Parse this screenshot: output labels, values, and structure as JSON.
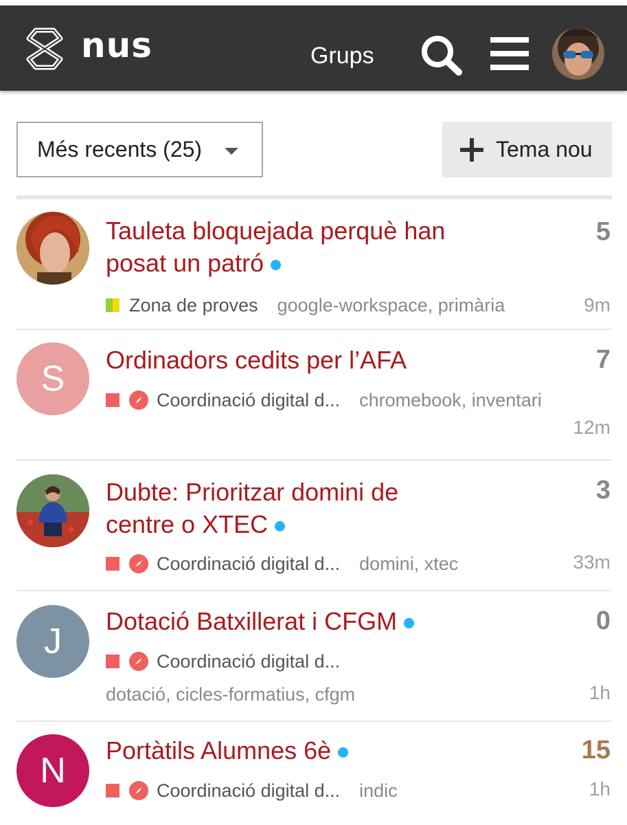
{
  "header": {
    "brand": "nus",
    "groups_link": "Grups",
    "search_icon": "search-icon",
    "menu_icon": "hamburger-icon",
    "user_avatar": "user-avatar"
  },
  "controls": {
    "filter_label": "Més recents (25)",
    "new_topic_label": "Tema nou"
  },
  "topics": [
    {
      "title_line1": "Tauleta bloquejada perquè han",
      "title_line2": "posat un patró",
      "unread": true,
      "count": "5",
      "category": "Zona de proves",
      "category_colors": [
        "#9acd32",
        "#f5d90f"
      ],
      "tags": "google-workspace, primària",
      "age": "9m",
      "avatar": "photo"
    },
    {
      "title_line1": "Ordinadors cedits per l’AFA",
      "count": "7",
      "category": "Coordinació digital d...",
      "category_color": "#f06060",
      "tags": "chromebook, inventari",
      "age": "12m",
      "avatar_letter": "S",
      "avatar_color": "#e8a0a0"
    },
    {
      "title_line1": "Dubte: Prioritzar domini de",
      "title_line2": "centre o XTEC",
      "unread": true,
      "count": "3",
      "category": "Coordinació digital d...",
      "category_color": "#f06060",
      "tags": "domini, xtec",
      "age": "33m",
      "avatar": "photo"
    },
    {
      "title_line1": "Dotació Batxillerat i CFGM",
      "unread": true,
      "count": "0",
      "category": "Coordinació digital d...",
      "category_color": "#f06060",
      "tags": "dotació, cicles-formatius, cfgm",
      "age": "1h",
      "avatar_letter": "J",
      "avatar_color": "#7d93a3"
    },
    {
      "title_line1": "Portàtils Alumnes 6è",
      "unread": true,
      "count": "15",
      "category": "Coordinació digital d...",
      "category_color": "#f06060",
      "tags": "indic",
      "age": "1h",
      "avatar_letter": "N",
      "avatar_color": "#c2185b"
    }
  ]
}
